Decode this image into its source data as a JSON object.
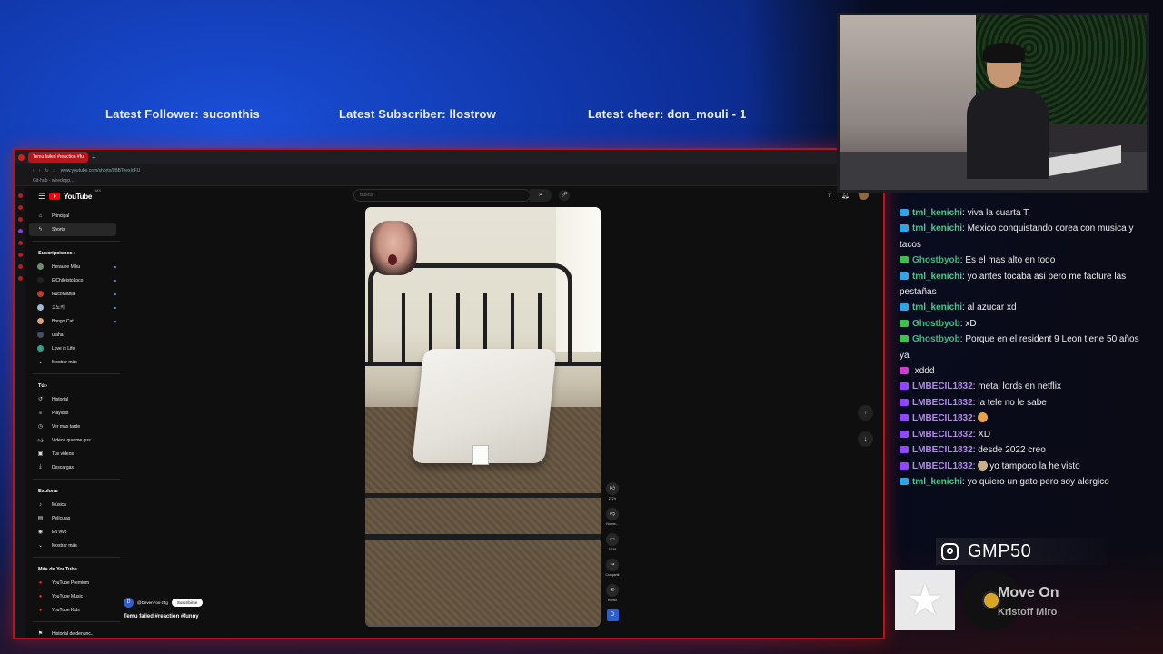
{
  "banner": {
    "follower": "Latest Follower: suconthis",
    "subscriber": "Latest Subscriber: llostrow",
    "cheer": "Latest cheer: don_mouli - 1"
  },
  "browser": {
    "tab_title": "Temu failed #reaction #fu",
    "url": "www.youtube.com/shorts/LBBTeexIdFU",
    "bookmark": "Git-hub - wiredopp..."
  },
  "youtube": {
    "logo": "YouTube",
    "logo_cc": "MX",
    "search_placeholder": "Buscar",
    "nav": [
      {
        "label": "Principal",
        "icon": "home-icon"
      },
      {
        "label": "Shorts",
        "icon": "shorts-icon",
        "active": true
      }
    ],
    "subs_header": "Suscripciones",
    "subs": [
      {
        "label": "Heraune Miku",
        "color": "#6a8f6a"
      },
      {
        "label": "ElChileistoLoco",
        "color": "#222222"
      },
      {
        "label": "RucoMania",
        "color": "#c23a2a"
      },
      {
        "label": "고노키",
        "color": "#9fb8d8"
      },
      {
        "label": "Bongo Cat",
        "color": "#e0a080"
      },
      {
        "label": "utaha",
        "color": "#44506a"
      },
      {
        "label": "Love is Life",
        "color": "#2aa58a"
      }
    ],
    "show_more": "Mostrar más",
    "you_header": "Tú",
    "you": [
      {
        "label": "Historial",
        "icon": "history-icon"
      },
      {
        "label": "Playlists",
        "icon": "playlist-icon"
      },
      {
        "label": "Ver más tarde",
        "icon": "clock-icon"
      },
      {
        "label": "Videos que me gus...",
        "icon": "like-icon"
      },
      {
        "label": "Tus videos",
        "icon": "video-icon"
      },
      {
        "label": "Descargas",
        "icon": "download-icon"
      }
    ],
    "explore_header": "Explorar",
    "explore": [
      {
        "label": "Música",
        "icon": "music-icon"
      },
      {
        "label": "Películas",
        "icon": "film-icon"
      },
      {
        "label": "En vivo",
        "icon": "live-icon"
      },
      {
        "label": "Mostrar más",
        "icon": "chevron-down-icon"
      }
    ],
    "more_header": "Más de YouTube",
    "more": [
      {
        "label": "YouTube Premium"
      },
      {
        "label": "YouTube Music"
      },
      {
        "label": "YouTube Kids"
      }
    ],
    "report": "Historial de denunc...",
    "short": {
      "channel": "@DevenFox-z4g",
      "channel_initial": "D",
      "subscribe": "Suscribirse",
      "title": "Temu failed #reaction #funny",
      "likes": "272 k",
      "dislike_label": "No me...",
      "comments": "5.748",
      "share_label": "Compartir",
      "remix_label": "Remix"
    }
  },
  "chat": [
    {
      "user": "tml_kenichi",
      "color": "#3ecf8e",
      "badge": "#2fa4e7",
      "text": "viva la cuarta T"
    },
    {
      "user": "tml_kenichi",
      "color": "#3ecf8e",
      "badge": "#2fa4e7",
      "text": "Mexico conquistando corea con musica y tacos"
    },
    {
      "user": "Ghostbyob",
      "color": "#3fb884",
      "badge": "#3fbf4f",
      "text": "Es el mas alto en todo"
    },
    {
      "user": "tml_kenichi",
      "color": "#3ecf8e",
      "badge": "#2fa4e7",
      "text": "yo antes tocaba asi pero me facture las pestañas"
    },
    {
      "user": "tml_kenichi",
      "color": "#3ecf8e",
      "badge": "#2fa4e7",
      "text": "al azucar xd"
    },
    {
      "user": "Ghostbyob",
      "color": "#3fb884",
      "badge": "#3fbf4f",
      "text": "xD"
    },
    {
      "user": "Ghostbyob",
      "color": "#3fb884",
      "badge": "#3fbf4f",
      "text": "Porque en el resident 9 Leon tiene 50 años ya"
    },
    {
      "user": "",
      "color": "#4a1f2a",
      "badge": "#d23bd2",
      "text": "xddd"
    },
    {
      "user": "LMBECIL1832",
      "color": "#b48be8",
      "badge": "#9147ff",
      "text": "metal lords en netflix"
    },
    {
      "user": "LMBECIL1832",
      "color": "#b48be8",
      "badge": "#9147ff",
      "text": "la tele no le sabe"
    },
    {
      "user": "LMBECIL1832",
      "color": "#b48be8",
      "badge": "#9147ff",
      "text": "",
      "emote": "cat-emote"
    },
    {
      "user": "LMBECIL1832",
      "color": "#b48be8",
      "badge": "#9147ff",
      "text": "XD"
    },
    {
      "user": "LMBECIL1832",
      "color": "#b48be8",
      "badge": "#9147ff",
      "text": "desde 2022 creo"
    },
    {
      "user": "LMBECIL1832",
      "color": "#b48be8",
      "badge": "#9147ff",
      "text": "yo tampoco la he visto",
      "emote": "face-emote"
    },
    {
      "user": "tml_kenichi",
      "color": "#3ecf8e",
      "badge": "#2fa4e7",
      "text": "yo quiero un gato pero soy alergico"
    }
  ],
  "social": {
    "icon": "instagram-icon",
    "handle": "GMP50"
  },
  "now_playing": {
    "title": "Move On",
    "artist": "Kristoff Miro"
  }
}
